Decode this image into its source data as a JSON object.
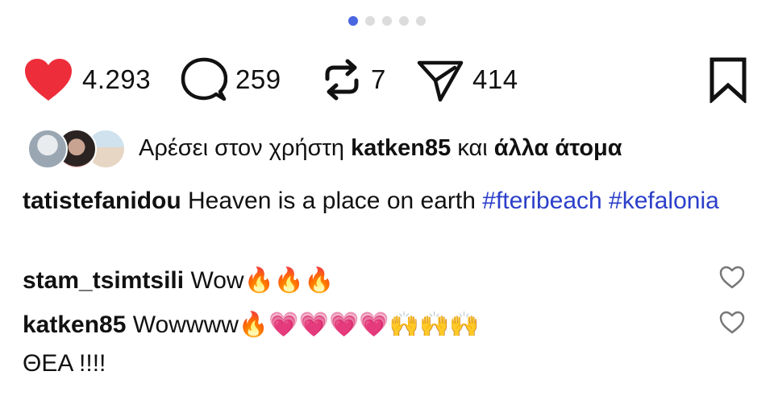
{
  "carousel": {
    "total": 5,
    "active_index": 0
  },
  "actions": {
    "like_count": "4.293",
    "comment_count": "259",
    "repost_count": "7",
    "share_count": "414",
    "like_color": "#ee2d3a"
  },
  "liked_by": {
    "prefix": "Αρέσει στον χρήστη",
    "user": "katken85",
    "conjunction": "και",
    "others": "άλλα άτομα"
  },
  "caption": {
    "username": "tatistefanidou",
    "text": "Heaven is a place on earth",
    "tags": [
      "#fteribeach",
      "#kefalonia"
    ]
  },
  "comments": [
    {
      "username": "stam_tsimtsili",
      "text": "Wow",
      "emoji": "🔥🔥🔥"
    },
    {
      "username": "katken85",
      "text": "Wowwww",
      "emoji_fire": "🔥",
      "emoji_hearts": "💗💗💗💗",
      "emoji_hands": "🙌🙌🙌",
      "second_line": "ΘΕΑ !!!!"
    }
  ],
  "icons": {
    "like": "heart-icon",
    "comment": "comment-bubble-icon",
    "repost": "repost-icon",
    "share": "send-icon",
    "save": "bookmark-icon",
    "comment_like": "heart-outline-icon"
  },
  "colors": {
    "hashtag": "#2b3fc9",
    "active_dot": "#4a66e0",
    "inactive_dot": "#dcdcdc"
  }
}
